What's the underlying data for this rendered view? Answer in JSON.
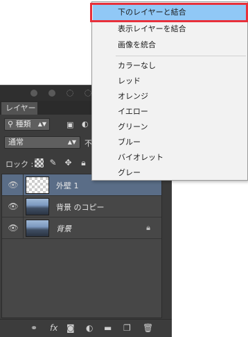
{
  "menu": {
    "items": [
      {
        "label": "下のレイヤーと結合"
      },
      {
        "label": "表示レイヤーを結合"
      },
      {
        "label": "画像を統合"
      },
      {
        "label": "カラーなし"
      },
      {
        "label": "レッド"
      },
      {
        "label": "オレンジ"
      },
      {
        "label": "イエロー"
      },
      {
        "label": "グリーン"
      },
      {
        "label": "ブルー"
      },
      {
        "label": "バイオレット"
      },
      {
        "label": "グレー"
      }
    ],
    "highlight_color": "#90c8f6",
    "annotation_color": "#e8303a"
  },
  "panel": {
    "tab_label": "レイヤー",
    "filter_label": "種類",
    "blend_mode": "通常",
    "opacity_label": "不",
    "lock_label": "ロック :"
  },
  "layers": [
    {
      "name": "外壁 1",
      "selected": true
    },
    {
      "name": "背景 のコピー",
      "selected": false
    },
    {
      "name": "背景",
      "selected": false,
      "locked": true
    }
  ],
  "colors": {
    "panel_bg": "#3c3c3c",
    "selected_row": "#5a6d87"
  }
}
